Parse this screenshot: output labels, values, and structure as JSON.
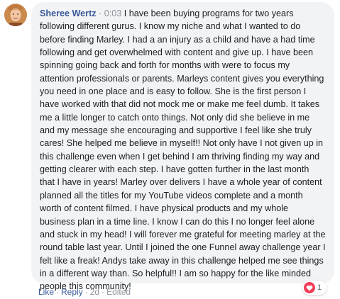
{
  "comment": {
    "author": "Sheree Wertz",
    "separator": "·",
    "timestamp": "0:03",
    "text": "I have been buying programs for two years following different gurus. I know my niche and what I wanted to do before finding Marley. I had a an injury as a child and have a had time following and get overwhelmed with content and give up. I have been spinning going back and forth for months with were to focus my attention professionals or parents. Marleys content gives you everything you need in one place and is easy to follow. She is the first person I have worked with that did not mock me or make me feel dumb. It takes me a little longer to catch onto things. Not only did she believe in me and my message she encouraging and supportive I feel like she truly cares! She helped me believe in myself!! Not only have I not given up in this challenge even when I get behind I am thriving finding my way and getting clearer with each step. I have gotten further in the last month that I have in years! Marley over delivers I have a whole year of content planned all the titles for my YouTube videos complete and a month worth of content filmed. I have physical products and my whole business plan in a time line. I know I can do this I no longer feel alone and stuck in my head! I will forever me grateful for meeting marley at the round table last year. Until I joined the one Funnel away challenge year I felt like a freak! Andys take away in this challenge helped me see things in a different way than. So helpful!! I am so happy for the like minded people this community!"
  },
  "actions": {
    "like": "Like",
    "reply": "Reply",
    "age": "2d",
    "edited": "Edited",
    "dot": "·"
  },
  "reaction": {
    "icon": "heart-icon",
    "count": "1",
    "color": "#f33e58"
  },
  "colors": {
    "author": "#385898",
    "bubble": "#f2f3f5",
    "meta": "#90949c",
    "text": "#1c1e21"
  }
}
